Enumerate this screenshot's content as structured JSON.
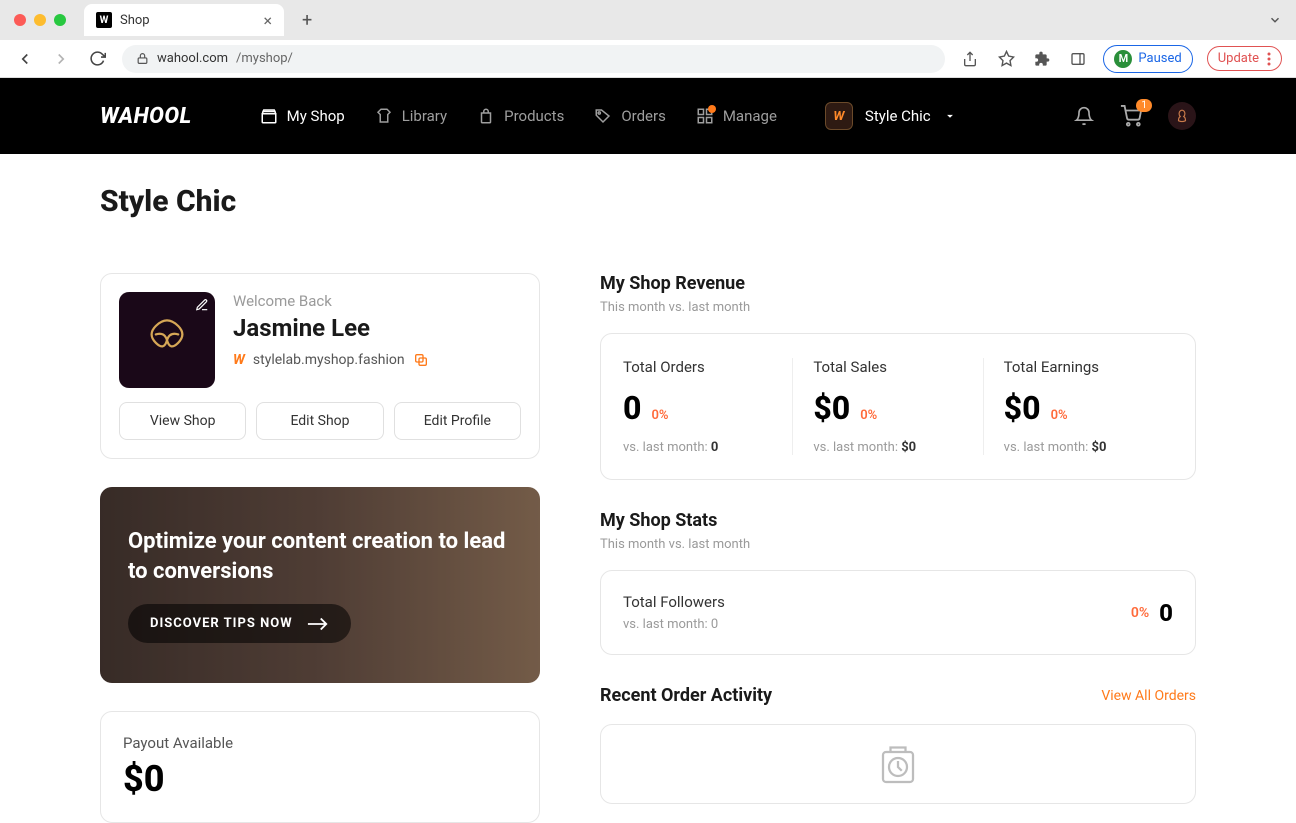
{
  "browser": {
    "tab_title": "Shop",
    "url_domain": "wahool.com",
    "url_path": "/myshop/",
    "paused_label": "Paused",
    "paused_initial": "M",
    "update_label": "Update"
  },
  "header": {
    "logo": "WAHOOL",
    "nav": {
      "myshop": "My Shop",
      "library": "Library",
      "products": "Products",
      "orders": "Orders",
      "manage": "Manage"
    },
    "shop_name": "Style Chic",
    "cart_count": "1"
  },
  "page": {
    "title": "Style Chic"
  },
  "profile": {
    "welcome": "Welcome Back",
    "name": "Jasmine Lee",
    "shop_url": "stylelab.myshop.fashion",
    "view_shop": "View Shop",
    "edit_shop": "Edit Shop",
    "edit_profile": "Edit Profile"
  },
  "banner": {
    "title": "Optimize your content creation to lead to conversions",
    "cta": "DISCOVER TIPS NOW"
  },
  "payout": {
    "label": "Payout Available",
    "value": "$0"
  },
  "revenue": {
    "title": "My Shop Revenue",
    "subtitle": "This month vs. last month",
    "items": [
      {
        "label": "Total Orders",
        "value": "0",
        "pct": "0%",
        "vs_label": "vs. last month:",
        "vs_value": "0"
      },
      {
        "label": "Total Sales",
        "value": "$0",
        "pct": "0%",
        "vs_label": "vs. last month:",
        "vs_value": "$0"
      },
      {
        "label": "Total Earnings",
        "value": "$0",
        "pct": "0%",
        "vs_label": "vs. last month:",
        "vs_value": "$0"
      }
    ]
  },
  "stats": {
    "title": "My Shop Stats",
    "subtitle": "This month vs. last month",
    "followers_label": "Total Followers",
    "followers_vs_label": "vs. last month:",
    "followers_vs_value": "0",
    "followers_pct": "0%",
    "followers_value": "0"
  },
  "recent": {
    "title": "Recent Order Activity",
    "view_all": "View All Orders"
  }
}
